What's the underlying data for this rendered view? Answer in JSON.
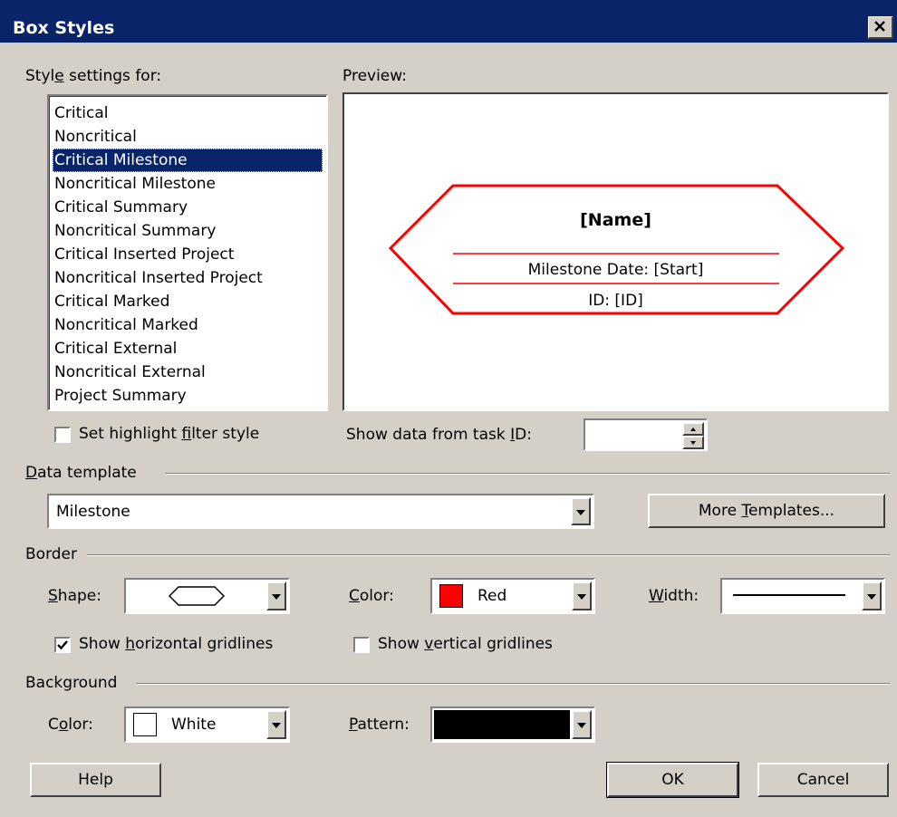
{
  "window": {
    "title": "Box Styles"
  },
  "style_settings": {
    "label_pre": "Styl",
    "label_ul": "e",
    "label_post": " settings for:",
    "items": [
      "Critical",
      "Noncritical",
      "Critical Milestone",
      "Noncritical Milestone",
      "Critical Summary",
      "Noncritical Summary",
      "Critical Inserted Project",
      "Noncritical Inserted Project",
      "Critical Marked",
      "Noncritical Marked",
      "Critical External",
      "Noncritical External",
      "Project Summary"
    ],
    "selected": "Critical Milestone"
  },
  "preview": {
    "label": "Preview:",
    "name_field": "[Name]",
    "row2": "Milestone Date: [Start]",
    "row3": "ID: [ID]",
    "border_color": "#ff0000"
  },
  "highlight": {
    "pre": "Set highlight ",
    "ul": "f",
    "post": "ilter style",
    "checked": false
  },
  "task_id": {
    "pre": "Show data from task ",
    "ul": "I",
    "post": "D:",
    "value": ""
  },
  "data_template": {
    "group_pre": "",
    "group_ul": "D",
    "group_post": "ata template",
    "value": "Milestone",
    "more_pre": "More ",
    "more_ul": "T",
    "more_post": "emplates..."
  },
  "border": {
    "group": "Border",
    "shape_ul": "S",
    "shape_post": "hape:",
    "color_ul": "C",
    "color_post": "olor:",
    "color_value": "Red",
    "color_hex": "#ff0000",
    "width_ul": "W",
    "width_post": "idth:",
    "hgrid_pre": "Show ",
    "hgrid_ul": "h",
    "hgrid_post": "orizontal gridlines",
    "hgrid_checked": true,
    "vgrid_pre": "Show ",
    "vgrid_ul": "v",
    "vgrid_post": "ertical gridlines",
    "vgrid_checked": false
  },
  "background": {
    "group": "Background",
    "color_pre": "C",
    "color_ul": "o",
    "color_post": "lor:",
    "color_value": "White",
    "color_hex": "#ffffff",
    "pattern_ul": "P",
    "pattern_post": "attern:",
    "pattern_hex": "#000000"
  },
  "buttons": {
    "help": "Help",
    "ok": "OK",
    "cancel": "Cancel"
  },
  "icons": {
    "close": "close-icon",
    "dropdown": "chevron-down-icon",
    "spinner": "spinner-icon"
  }
}
